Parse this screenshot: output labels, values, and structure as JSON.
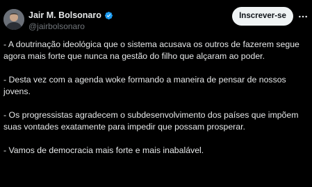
{
  "author": {
    "display_name": "Jair M. Bolsonaro",
    "handle": "@jairbolsonaro",
    "verified": true,
    "verified_color": "#1d9bf0"
  },
  "actions": {
    "subscribe_label": "Inscrever-se",
    "more_icon": "more-horizontal-icon"
  },
  "tweet": {
    "paragraphs": [
      "- A doutrinação ideológica que o sistema acusava os outros de fazerem segue agora mais forte que nunca na gestão do filho que alçaram ao poder.",
      "- Desta vez com a agenda woke formando a maneira de pensar de nossos jovens.",
      "- Os progressistas agradecem o subdesenvolvimento dos países que impõem suas vontades exatamente para impedir que possam prosperar.",
      "- Vamos de democracia mais forte e mais inabalável."
    ]
  },
  "colors": {
    "background": "#000000",
    "text": "#e7e9ea",
    "secondary_text": "#71767b",
    "button_bg": "#eff3f4",
    "button_text": "#0f1419"
  }
}
